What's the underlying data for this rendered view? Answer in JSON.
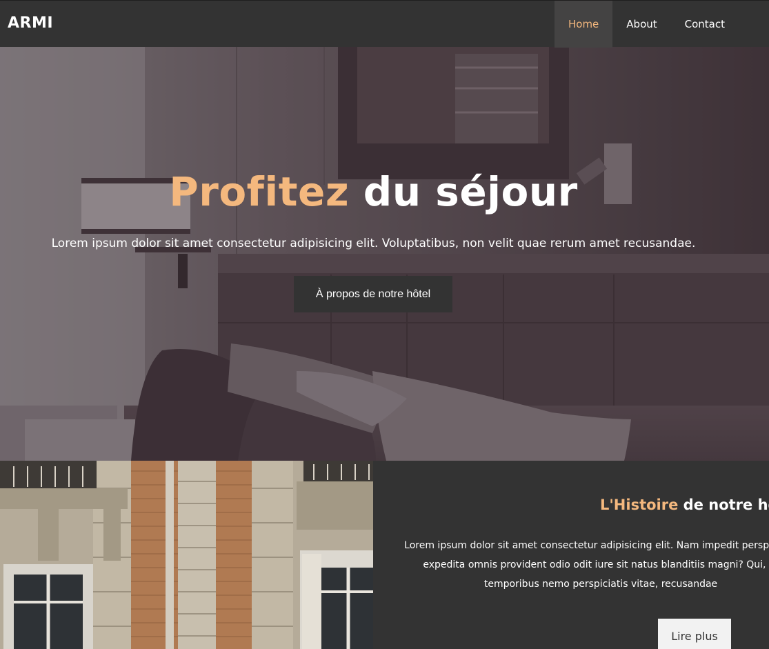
{
  "nav": {
    "brand": "ARMI",
    "links": [
      {
        "label": "Home",
        "active": true
      },
      {
        "label": "About",
        "active": false
      },
      {
        "label": "Contact",
        "active": false
      }
    ]
  },
  "hero": {
    "title_accent": "Profitez",
    "title_rest": " du séjour",
    "text": "Lorem ipsum dolor sit amet consectetur adipisicing elit. Voluptatibus, non velit quae rerum amet recusandae.",
    "button_label": "À propos de notre hôtel"
  },
  "history": {
    "title_accent": "L'Histoire",
    "title_rest": " de notre hôtel",
    "body_lines": [
      "Lorem ipsum dolor sit amet consectetur adipisicing elit. Nam impedit perspiciatis",
      "expedita omnis provident odio odit iure sit natus blanditiis magni? Qui, m",
      "temporibus nemo perspiciatis vitae, recusandae"
    ],
    "button_label": "Lire plus"
  },
  "colors": {
    "accent": "#f4b87e",
    "nav_background": "#333333",
    "active_nav_background": "#444343"
  }
}
